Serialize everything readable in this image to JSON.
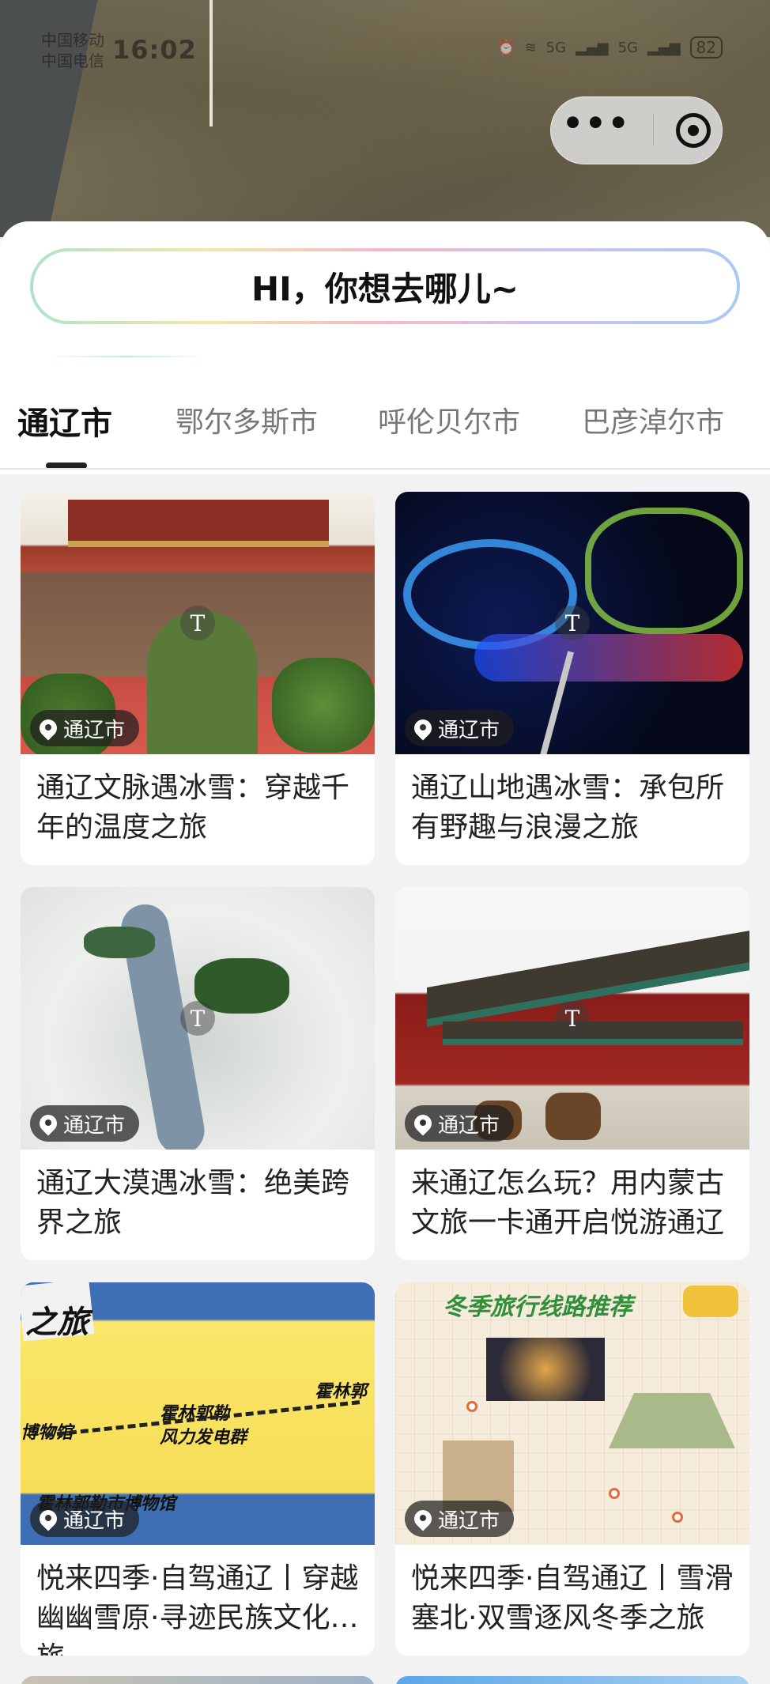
{
  "status_bar": {
    "carrier_1": "中国移动",
    "carrier_2": "中国电信",
    "time": "16:02",
    "signal_1": "5G",
    "signal_2": "5G",
    "battery": "82"
  },
  "search": {
    "prompt": "HI，你想去哪儿~"
  },
  "tabs": [
    {
      "label": "通辽市",
      "active": true
    },
    {
      "label": "鄂尔多斯市",
      "active": false
    },
    {
      "label": "呼伦贝尔市",
      "active": false
    },
    {
      "label": "巴彦淖尔市",
      "active": false
    }
  ],
  "cards": [
    {
      "location": "通辽市",
      "title": "通辽文脉遇冰雪：穿越千年的温度之旅",
      "image": "gate"
    },
    {
      "location": "通辽市",
      "title": "通辽山地遇冰雪：承包所有野趣与浪漫之旅",
      "image": "neon"
    },
    {
      "location": "通辽市",
      "title": "通辽大漠遇冰雪：绝美跨界之旅",
      "image": "desert"
    },
    {
      "location": "通辽市",
      "title": "来通辽怎么玩？用内蒙古文旅一卡通开启悦游通辽",
      "image": "palace"
    },
    {
      "location": "通辽市",
      "title": "悦来四季·自驾通辽丨穿越幽幽雪原·寻迹民族文化之旅",
      "image": "map"
    },
    {
      "location": "通辽市",
      "title": "悦来四季·自驾通辽丨雪滑塞北·双雪逐风冬季之旅",
      "image": "route"
    }
  ],
  "image_text": {
    "map_lbl_1": "之旅",
    "map_lbl_2": "霍林郭勒",
    "map_lbl_3": "风力发电群",
    "map_lbl_4": "霍林郭勒市博物馆",
    "map_lbl_5": "博物馆",
    "map_lbl_6": "霍林郭",
    "route_header": "冬季旅行线路推荐"
  },
  "colors": {
    "accent": "#222222",
    "tab_inactive": "#777777",
    "badge_bg": "#1e1e1e"
  }
}
